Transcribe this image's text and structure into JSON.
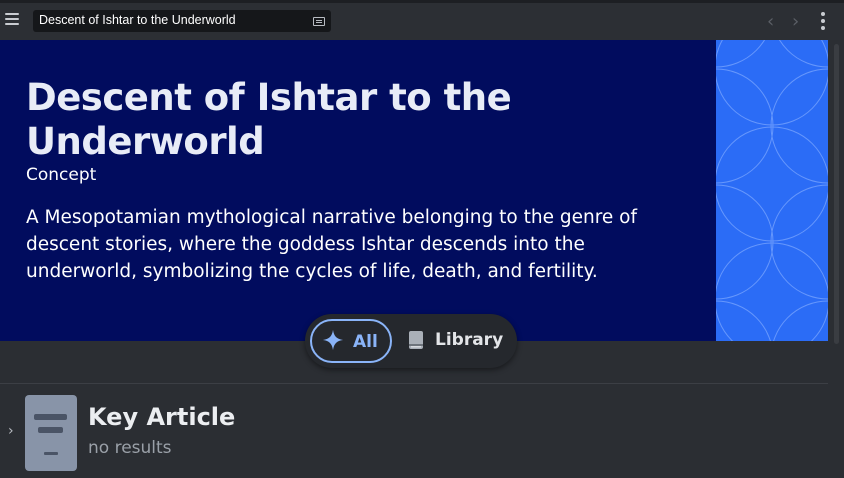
{
  "toolbar": {
    "tab_title": "Descent of Ishtar to the Underworld",
    "icons": [
      "menu-icon",
      "keyboard-icon",
      "chevron-left-icon",
      "chevron-right-icon",
      "more-vertical-icon"
    ]
  },
  "hero": {
    "title": "Descent of Ishtar to the Underworld",
    "type": "Concept",
    "description": "A Mesopotamian mythological narrative belonging to the genre of descent stories, where the goddess Ishtar descends into the underworld, symbolizing the cycles of life, death, and fertility."
  },
  "filters": {
    "all_label": "All",
    "library_label": "Library",
    "selected": "All"
  },
  "key_article": {
    "title": "Key Article",
    "subtitle": "no results"
  },
  "colors": {
    "hero_bg": "#010c5e",
    "pattern_bg": "#2b6cf6",
    "accent": "#8ab4f8",
    "page_bg": "#2b2e33"
  }
}
